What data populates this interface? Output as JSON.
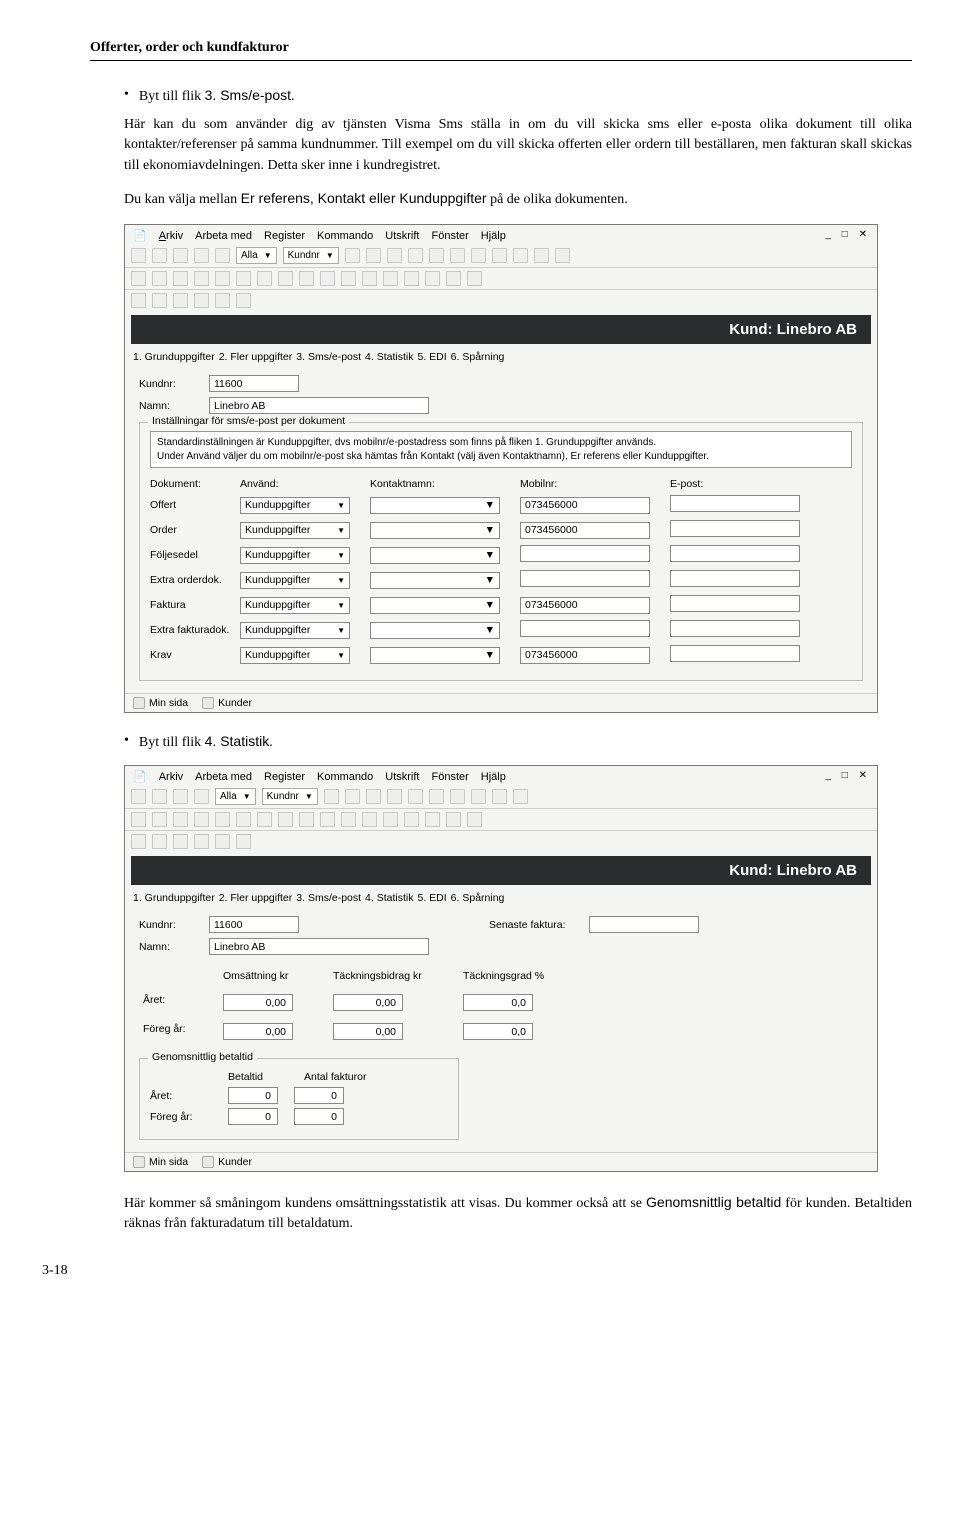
{
  "doc_header": "Offerter, order och kundfakturor",
  "bullet1_prefix": "Byt till flik ",
  "bullet1_tab": "3. Sms/e-post",
  "bullet1_suffix": ".",
  "para1a": "Här  kan du som använder dig av tjänsten Visma Sms ställa in om du vill skicka sms eller e-posta olika dokument till olika kontakter/referenser på samma kundnummer. Till exempel om du vill skicka offerten eller ordern till beställaren, men fakturan skall skickas till ekonomiavdelningen. Detta sker inne i kundregistret.",
  "para1b_prefix": "Du kan välja mellan ",
  "para1b_opts": "Er referens, Kontakt eller Kunduppgifter",
  "para1b_suffix": " på de olika dokumenten.",
  "menus": {
    "arkiv": "Arkiv",
    "arbeta": "Arbeta med",
    "register": "Register",
    "kommando": "Kommando",
    "utskrift": "Utskrift",
    "fonster": "Fönster",
    "hjalp": "Hjälp"
  },
  "tb_sel1": "Alla",
  "tb_sel2": "Kundnr",
  "badge": "Kund: Linebro AB",
  "tabs": {
    "t1": "1. Grunduppgifter",
    "t2": "2. Fler uppgifter",
    "t3": "3. Sms/e-post",
    "t4": "4. Statistik",
    "t5": "5. EDI",
    "t6": "6. Spårning"
  },
  "labels": {
    "kundnr": "Kundnr:",
    "namn": "Namn:"
  },
  "kundnr_val": "11600",
  "namn_val": "Linebro AB",
  "group_title": "Inställningar för sms/e-post per dokument",
  "info_line1": "Standardinställningen är Kunduppgifter, dvs mobilnr/e-postadress som finns på fliken 1. Grunduppgifter används.",
  "info_line2": "Under Använd väljer du om mobilnr/e-post ska hämtas från Kontakt (välj även Kontaktnamn), Er referens eller Kunduppgifter.",
  "cols": {
    "dokument": "Dokument:",
    "anvand": "Använd:",
    "kontakt": "Kontaktnamn:",
    "mobil": "Mobilnr:",
    "epost": "E-post:"
  },
  "rows": [
    {
      "doc": "Offert",
      "use": "Kunduppgifter",
      "mob": "073456000"
    },
    {
      "doc": "Order",
      "use": "Kunduppgifter",
      "mob": "073456000"
    },
    {
      "doc": "Följesedel",
      "use": "Kunduppgifter",
      "mob": ""
    },
    {
      "doc": "Extra orderdok.",
      "use": "Kunduppgifter",
      "mob": ""
    },
    {
      "doc": "Faktura",
      "use": "Kunduppgifter",
      "mob": "073456000"
    },
    {
      "doc": "Extra fakturadok.",
      "use": "Kunduppgifter",
      "mob": ""
    },
    {
      "doc": "Krav",
      "use": "Kunduppgifter",
      "mob": "073456000"
    }
  ],
  "footer": {
    "minsida": "Min sida",
    "kunder": "Kunder"
  },
  "bullet2_prefix": "Byt till flik ",
  "bullet2_tab": "4. Statistik",
  "bullet2_suffix": ".",
  "stat": {
    "senaste": "Senaste faktura:",
    "oms": "Omsättning kr",
    "tb": "Täckningsbidrag kr",
    "tg": "Täckningsgrad %",
    "aret": "Året:",
    "foreg": "Föreg år:",
    "v_oms": "0,00",
    "v_tb": "0,00",
    "v_tg": "0,0",
    "group2": "Genomsnittlig betaltid",
    "betaltid": "Betaltid",
    "antal": "Antal fakturor",
    "v_bt": "0",
    "v_af": "0"
  },
  "para2_prefix": "Här kommer så småningom kundens omsättningsstatistik att visas. Du kommer också att se ",
  "para2_bold": "Genomsnittlig betaltid",
  "para2_suffix": " för kunden. Betaltiden räknas från fakturadatum till betaldatum.",
  "page_num": "3-18"
}
